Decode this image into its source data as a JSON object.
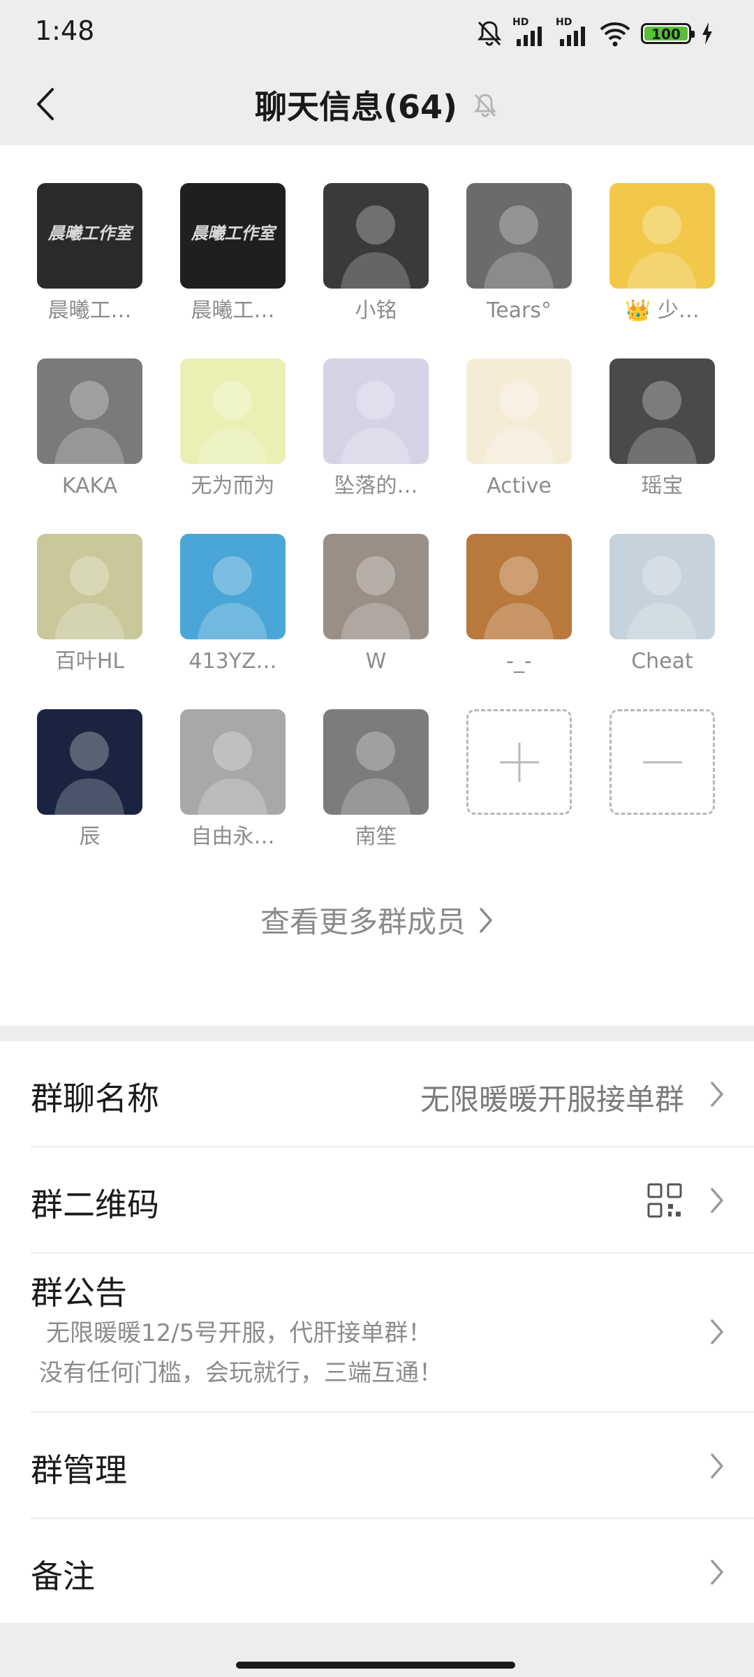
{
  "status_bar": {
    "time": "1:48",
    "battery": "100",
    "signal_1": "HD",
    "signal_2": "HD"
  },
  "nav": {
    "title": "聊天信息(64)"
  },
  "members": [
    {
      "name": "晨曦工…",
      "avatar_text": "晨曦工作室",
      "bg": "#2a2a2a"
    },
    {
      "name": "晨曦工…",
      "avatar_text": "晨曦工作室",
      "bg": "#1f1f1f"
    },
    {
      "name": "小铭",
      "bg": "#3a3a3a"
    },
    {
      "name": "Tears°",
      "bg": "#6b6b6b"
    },
    {
      "name": "👑 少…",
      "bg": "#f1c84a"
    },
    {
      "name": "KAKA",
      "bg": "#7a7a7a"
    },
    {
      "name": "无为而为",
      "bg": "#eaf0b4"
    },
    {
      "name": "坠落的…",
      "bg": "#d7d2e6"
    },
    {
      "name": "Active",
      "bg": "#f5ecd8"
    },
    {
      "name": "瑶宝",
      "bg": "#4a4a4a"
    },
    {
      "name": "百叶HL",
      "bg": "#c9c89a"
    },
    {
      "name": "413YZ…",
      "bg": "#4aa6d6"
    },
    {
      "name": "W",
      "bg": "#9a8f86"
    },
    {
      "name": "-_-",
      "bg": "#b9793c"
    },
    {
      "name": "Cheat",
      "bg": "#c6d2dc"
    },
    {
      "name": "辰",
      "bg": "#1a2440"
    },
    {
      "name": "自由永…",
      "bg": "#a8a8a8"
    },
    {
      "name": "南笙",
      "bg": "#7c7c7c"
    }
  ],
  "more_members": "查看更多群成员",
  "settings": {
    "group_name_label": "群聊名称",
    "group_name_value": "无限暖暖开服接单群",
    "qr_label": "群二维码",
    "notice_label": "群公告",
    "notice_line1": "无限暖暖12/5号开服，代肝接单群！",
    "notice_line2": "没有任何门槛，会玩就行，三端互通！",
    "manage_label": "群管理",
    "remark_label": "备注"
  }
}
